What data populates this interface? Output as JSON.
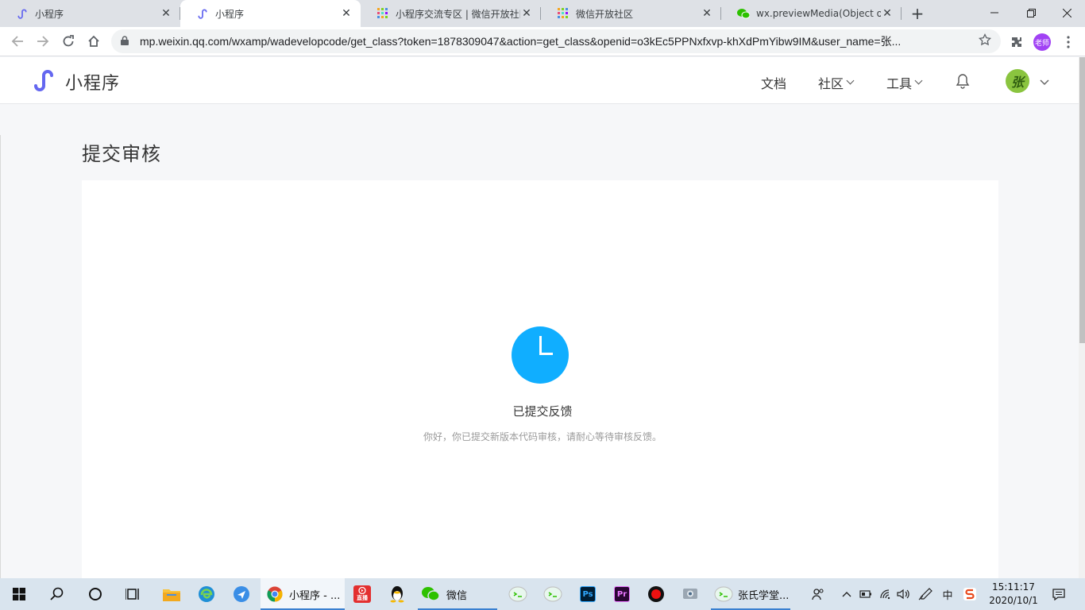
{
  "browser": {
    "tabs": [
      {
        "title": "小程序",
        "active": false,
        "icon": "miniprogram-icon"
      },
      {
        "title": "小程序",
        "active": true,
        "icon": "miniprogram-icon"
      },
      {
        "title": "小程序交流专区 | 微信开放社区",
        "active": false,
        "icon": "community-icon"
      },
      {
        "title": "微信开放社区",
        "active": false,
        "icon": "community-icon"
      },
      {
        "title": "wx.previewMedia(Object obj",
        "active": false,
        "icon": "wechat-icon"
      }
    ],
    "close_glyph": "✕",
    "newtab_glyph": "+",
    "url": "mp.weixin.qq.com/wxamp/wadevelopcode/get_class?token=1878309047&action=get_class&openid=o3kEc5PPNxfxvp-khXdPmYibw9IM&user_name=张...",
    "profile_label": "老师"
  },
  "site": {
    "logo_text": "小程序",
    "nav": {
      "docs": "文档",
      "community": "社区",
      "tools": "工具"
    },
    "avatar_text": "张"
  },
  "page": {
    "title": "提交审核",
    "status_title": "已提交反馈",
    "status_desc": "你好，你已提交新版本代码审核，请耐心等待审核反馈。"
  },
  "taskbar": {
    "chrome_label": "小程序 - ...",
    "wechat_label": "微信",
    "tencent_video_label": "直播",
    "zhangshi_label": "张氏学堂...",
    "ps_label": "Ps",
    "pr_label": "Pr",
    "ime_label": "中",
    "clock_time": "15:11:17",
    "clock_date": "2020/10/1"
  },
  "colors": {
    "status_icon": "#10aeff",
    "logo": "#6467f0",
    "avatar": "#8ac43f"
  }
}
